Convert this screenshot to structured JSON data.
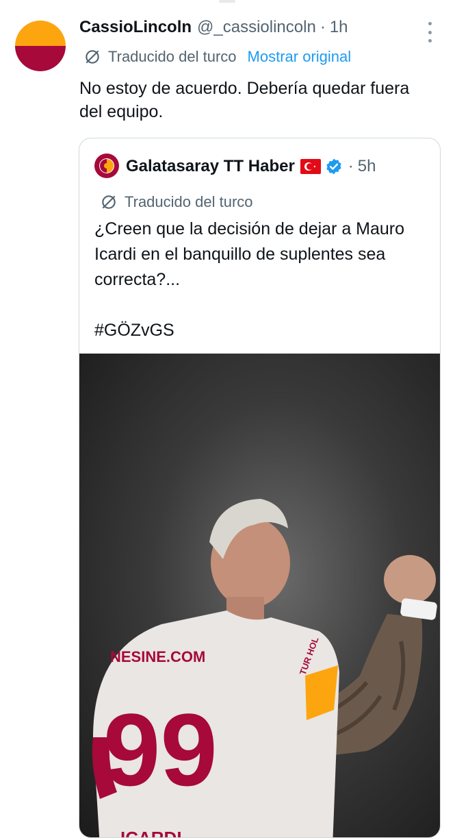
{
  "tweet": {
    "display_name": "CassioLincoln",
    "handle": "@_cassiolincoln",
    "separator": "·",
    "time": "1h",
    "translated_label": "Traducido del turco",
    "show_original": "Mostrar original",
    "text": "No estoy de acuerdo. Debería quedar fuera del equipo.",
    "more_icon": "more-vertical-icon",
    "translate_icon": "translate-icon"
  },
  "quote": {
    "display_name": "Galatasaray TT Haber",
    "separator": "·",
    "time": "5h",
    "translated_label": "Traducido del turco",
    "text": "¿Creen que la decisión de dejar a Mauro Icardi en el banquillo de suplentes sea correcta?...",
    "hashtag": "#GÖZvGS",
    "flag_icon": "turkey-flag-icon",
    "verified_icon": "verified-badge-icon",
    "media": {
      "sponsor_text": "NESINE.COM",
      "shirt_number": "99",
      "name_on_shirt": "ICARDI",
      "sleeve_text": "TUR HOL"
    }
  },
  "colors": {
    "accent": "#1d9bf0",
    "secondary_text": "#536471",
    "galatasaray_red": "#a6093a",
    "galatasaray_yellow": "#fda50f"
  }
}
